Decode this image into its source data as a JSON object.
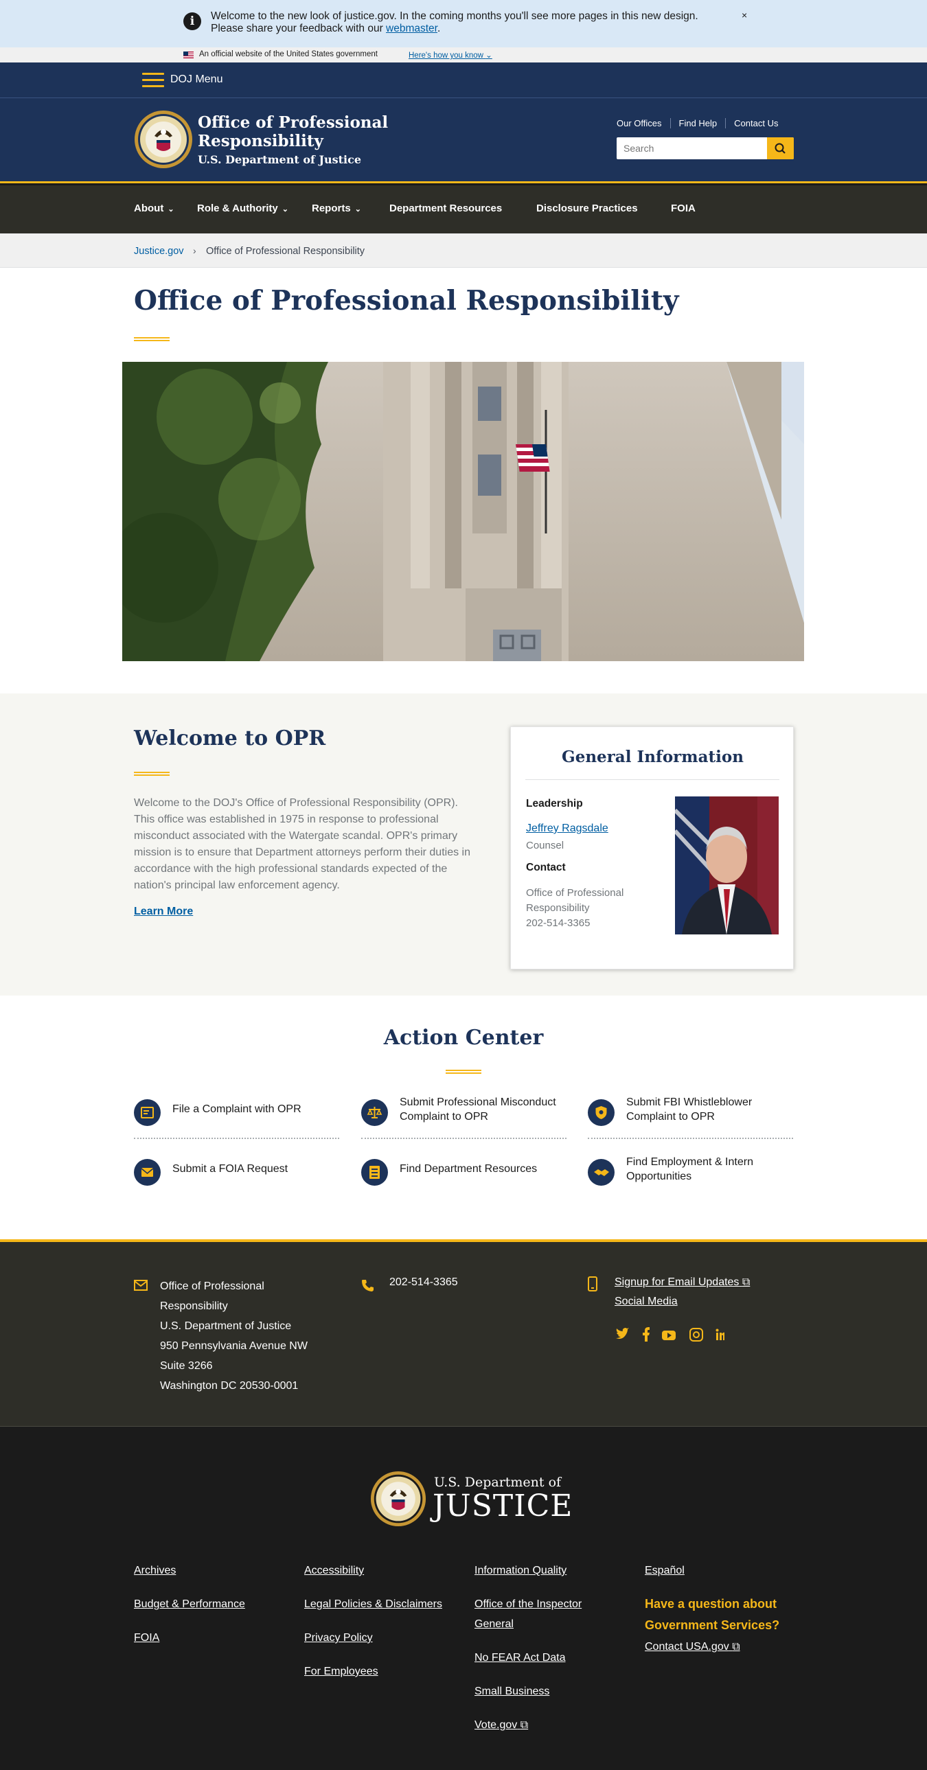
{
  "alert": {
    "message": "Welcome to the new look of justice.gov. In the coming months you'll see more pages in this new design. Please share your feedback with our ",
    "link": "webmaster",
    "period": ".",
    "close": "×"
  },
  "gov_banner": {
    "text": "An official website of the United States government",
    "link": "Here's how you know"
  },
  "topbar": {
    "menu_label": "DOJ Menu"
  },
  "header": {
    "title_line1": "Office of Professional",
    "title_line2": "Responsibility",
    "department": "U.S. Department of Justice",
    "utility_links": [
      "Our Offices",
      "Find Help",
      "Contact Us"
    ],
    "search_placeholder": "Search"
  },
  "nav": {
    "items": [
      {
        "label": "About",
        "chevron": "⌄"
      },
      {
        "label": "Role & Authority",
        "chevron": "⌄"
      },
      {
        "label": "Reports",
        "chevron": "⌄"
      },
      {
        "label": "Department Resources"
      },
      {
        "label": "Disclosure Practices"
      },
      {
        "label": "FOIA"
      }
    ]
  },
  "breadcrumb": {
    "root": "Justice.gov",
    "separator": "›",
    "current": "Office of Professional Responsibility"
  },
  "page": {
    "title": "Office of Professional Responsibility"
  },
  "welcome": {
    "heading": "Welcome to OPR",
    "body": "Welcome to the DOJ's Office of Professional Responsibility (OPR). This office was established in 1975 in response to professional misconduct associated with the Watergate scandal.  OPR's primary mission is to ensure that Department attorneys perform their duties in accordance with the high professional standards expected of the nation's principal law enforcement agency.",
    "learn_more": "Learn More"
  },
  "general_info": {
    "heading": "General Information",
    "leadership_heading": "Leadership",
    "leader_name": "Jeffrey Ragsdale",
    "leader_role": "Counsel",
    "contact_heading": "Contact",
    "contact_org": "Office of Professional Responsibility",
    "contact_phone": "202-514-3365"
  },
  "action_center": {
    "heading": "Action Center",
    "items": [
      {
        "label": "File a Complaint with OPR",
        "icon": "complaint-form-icon"
      },
      {
        "label": "Submit Professional Misconduct Complaint to OPR",
        "icon": "scales-icon"
      },
      {
        "label": "Submit FBI Whistleblower Complaint to OPR",
        "icon": "shield-badge-icon"
      },
      {
        "label": "Submit a FOIA Request",
        "icon": "envelope-icon"
      },
      {
        "label": "Find Department Resources",
        "icon": "checklist-icon"
      },
      {
        "label": "Find Employment & Intern Opportunities",
        "icon": "handshake-icon"
      }
    ]
  },
  "footer_contact": {
    "address_lines": [
      "Office of Professional Responsibility",
      "U.S. Department of Justice",
      "950 Pennsylvania Avenue NW",
      "Suite 3266",
      "Washington DC 20530-0001"
    ],
    "phone": "202-514-3365",
    "email_updates": "Signup for Email Updates",
    "social_media": "Social Media",
    "social_icons": [
      "twitter-icon",
      "facebook-icon",
      "youtube-icon",
      "instagram-icon",
      "linkedin-icon"
    ]
  },
  "footer": {
    "brand_top": "U.S. Department of",
    "brand_main": "JUSTICE",
    "col1": [
      "Archives",
      "Budget & Performance",
      "FOIA"
    ],
    "col2": [
      "Accessibility",
      "Legal Policies & Disclaimers",
      "Privacy Policy",
      "For Employees"
    ],
    "col3": [
      "Information Quality",
      "Office of the Inspector General",
      "No FEAR Act Data",
      "Small Business",
      "Vote.gov"
    ],
    "col4_link": "Español",
    "question": "Have a question about Government Services?",
    "contact_usa": "Contact USA.gov"
  },
  "colors": {
    "navy": "#1d3359",
    "gold": "#f5b719",
    "link": "#005ea2",
    "olive_dark": "#2e2e28"
  }
}
